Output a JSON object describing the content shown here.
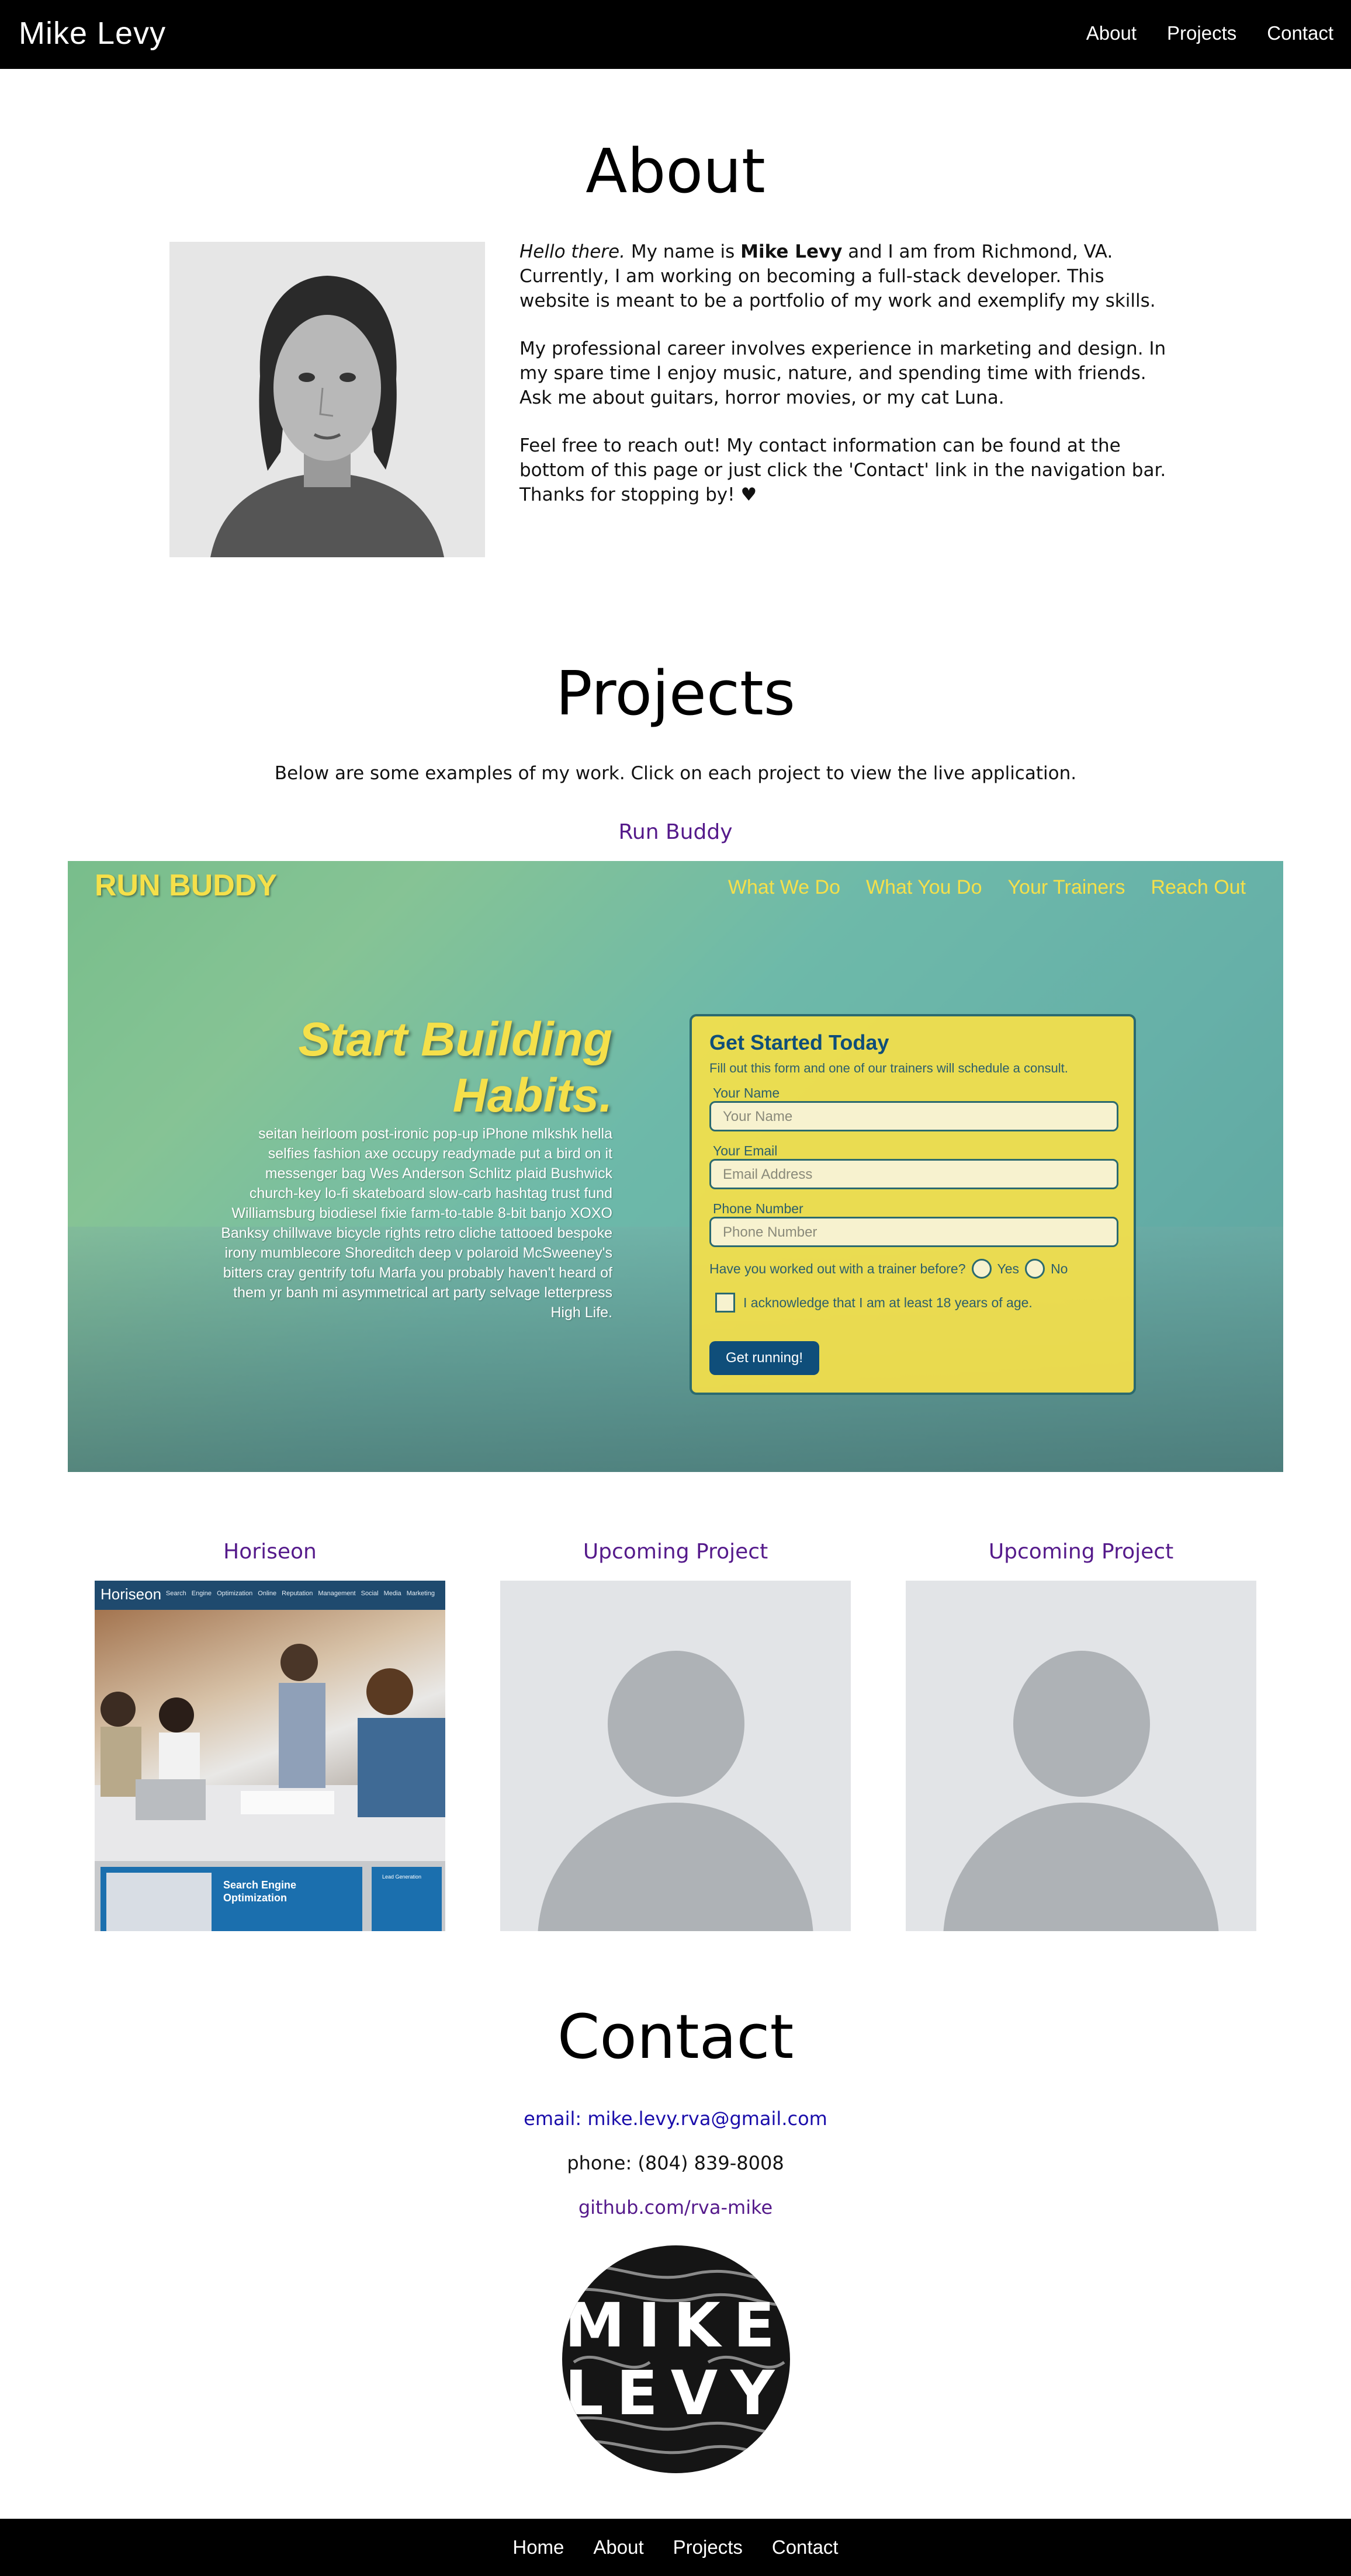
{
  "header": {
    "brand": "Mike Levy",
    "nav": [
      "About",
      "Projects",
      "Contact"
    ]
  },
  "about": {
    "heading": "About",
    "intro_em": "Hello there.",
    "intro_1": " My name is ",
    "name": "Mike Levy",
    "intro_2": " and I am from Richmond, VA. Currently, I am working on becoming a full-stack developer. This website is meant to be a portfolio of my work and exemplify my skills.",
    "paragraph_2": "My professional career involves experience in marketing and design. In my spare time I enjoy music, nature, and spending time with friends. Ask me about guitars, horror movies, or my cat Luna.",
    "paragraph_3": "Feel free to reach out! My contact information can be found at the bottom of this page or just click the 'Contact' link in the navigation bar. Thanks for stopping by! ♥"
  },
  "projects": {
    "heading": "Projects",
    "intro": "Below are some examples of my work. Click on each project to view the live application.",
    "featured": {
      "title": "Run Buddy",
      "logo": "RUN BUDDY",
      "nav": [
        "What We Do",
        "What You Do",
        "Your Trainers",
        "Reach Out"
      ],
      "hero_line1": "Start Building",
      "hero_line2": "Habits.",
      "lorem": "seitan heirloom post-ironic pop-up iPhone mlkshk hella selfies fashion axe occupy readymade put a bird on it messenger bag Wes Anderson Schlitz plaid Bushwick church-key lo-fi skateboard slow-carb hashtag trust fund Williamsburg biodiesel fixie farm-to-table 8-bit banjo XOXO Banksy chillwave bicycle rights retro cliche tattooed bespoke irony mumblecore Shoreditch deep v polaroid McSweeney's bitters cray gentrify tofu Marfa you probably haven't heard of them yr banh mi asymmetrical art party selvage letterpress High Life.",
      "form": {
        "title": "Get Started Today",
        "subtitle": "Fill out this form and one of our trainers will schedule a consult.",
        "name_label": "Your Name",
        "name_placeholder": "Your Name",
        "email_label": "Your Email",
        "email_placeholder": "Email Address",
        "phone_label": "Phone Number",
        "phone_placeholder": "Phone Number",
        "trainer_question": "Have you worked out with a trainer before?",
        "yes": "Yes",
        "no": "No",
        "ack": "I acknowledge that I am at least 18 years of age.",
        "submit": "Get running!"
      }
    },
    "cards": [
      {
        "title": "Horiseon",
        "logo": "Horiseon",
        "nav": "Search Engine Optimization   Online Reputation Management   Social Media Marketing",
        "card_title": "Search Engine Optimization",
        "card2_title": "Lead Generation"
      },
      {
        "title": "Upcoming Project"
      },
      {
        "title": "Upcoming Project"
      }
    ]
  },
  "contact": {
    "heading": "Contact",
    "email": "email: mike.levy.rva@gmail.com",
    "phone": "phone: (804) 839-8008",
    "github": "github.com/rva-mike",
    "logo_line1": "MIKE",
    "logo_line2": "LEVY"
  },
  "footer": {
    "nav": [
      "Home",
      "About",
      "Projects",
      "Contact"
    ]
  },
  "colors": {
    "link_visited": "#551a8b",
    "link": "#1a0dab",
    "runbuddy_yellow": "#f5e04a",
    "runbuddy_blue": "#0f4e7a"
  }
}
